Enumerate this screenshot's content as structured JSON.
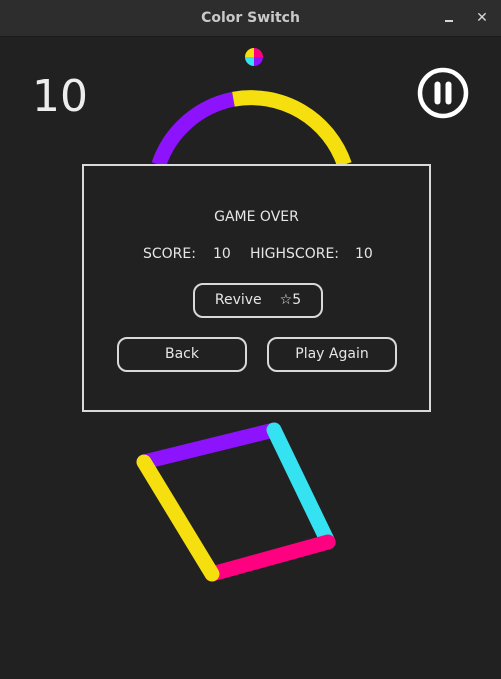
{
  "window": {
    "title": "Color Switch",
    "minimize_label": "minimize",
    "close_glyph": "✕"
  },
  "hud": {
    "score": "10"
  },
  "game_over": {
    "title": "GAME OVER",
    "score_label": "SCORE:",
    "score_value": "10",
    "highscore_label": "HIGHSCORE:",
    "highscore_value": "10",
    "revive_label": "Revive",
    "revive_cost": "☆5",
    "back_label": "Back",
    "play_again_label": "Play Again"
  },
  "palette": {
    "purple": "#8c13fb",
    "yellow": "#f6df0e",
    "cyan": "#35e2f2",
    "pink": "#ff0080",
    "background": "#212121"
  },
  "obstacles": {
    "ring_segments": [
      "purple",
      "yellow",
      "cyan",
      "pink"
    ],
    "square_sides": [
      "purple",
      "cyan",
      "pink",
      "yellow"
    ]
  }
}
